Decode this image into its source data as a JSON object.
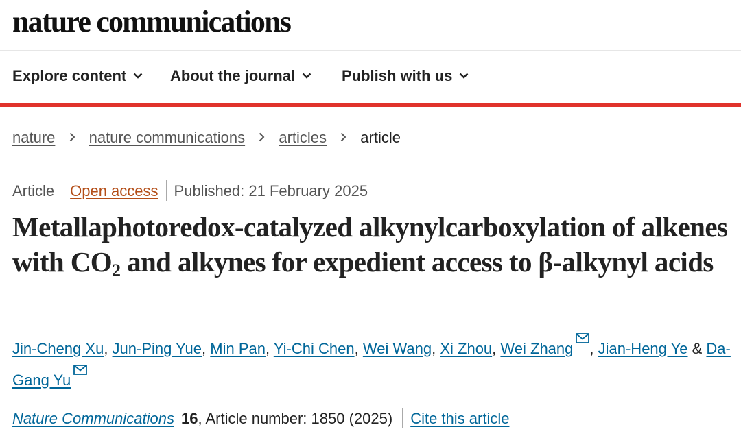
{
  "header": {
    "logo_text": "nature communications"
  },
  "nav": {
    "items": [
      {
        "label": "Explore content"
      },
      {
        "label": "About the journal"
      },
      {
        "label": "Publish with us"
      }
    ]
  },
  "breadcrumb": {
    "items": [
      {
        "label": "nature"
      },
      {
        "label": "nature communications"
      },
      {
        "label": "articles"
      },
      {
        "label": "article"
      }
    ]
  },
  "article": {
    "type": "Article",
    "access": "Open access",
    "published": "Published: 21 February 2025",
    "title_part1": "Metallaphotoredox-catalyzed alkynylcarboxylation of alkenes with CO",
    "title_sub": "2",
    "title_part2": " and alkynes for expedient access to β-alkynyl acids",
    "authors": [
      {
        "name": "Jin-Cheng Xu",
        "sep": ", "
      },
      {
        "name": "Jun-Ping Yue",
        "sep": ", "
      },
      {
        "name": "Min Pan",
        "sep": ", "
      },
      {
        "name": "Yi-Chi Chen",
        "sep": ", "
      },
      {
        "name": "Wei Wang",
        "sep": ", "
      },
      {
        "name": "Xi Zhou",
        "sep": ", "
      },
      {
        "name": "Wei Zhang",
        "sep": ", "
      },
      {
        "name": "Jian-Heng Ye",
        "sep": " & "
      },
      {
        "name": "Da-Gang Yu",
        "sep": ""
      }
    ],
    "journal": "Nature Communications",
    "volume": "16",
    "article_number": ", Article number: 1850 (2025)",
    "cite_label": "Cite this article"
  },
  "colors": {
    "accent_red": "#e0322b",
    "link_blue": "#006699",
    "open_access_orange": "#b34d17"
  },
  "icons": {
    "nav_dropdown": "chevron-down-icon",
    "breadcrumb_separator": "chevron-right-icon",
    "corresponding_author": "mail-icon"
  }
}
